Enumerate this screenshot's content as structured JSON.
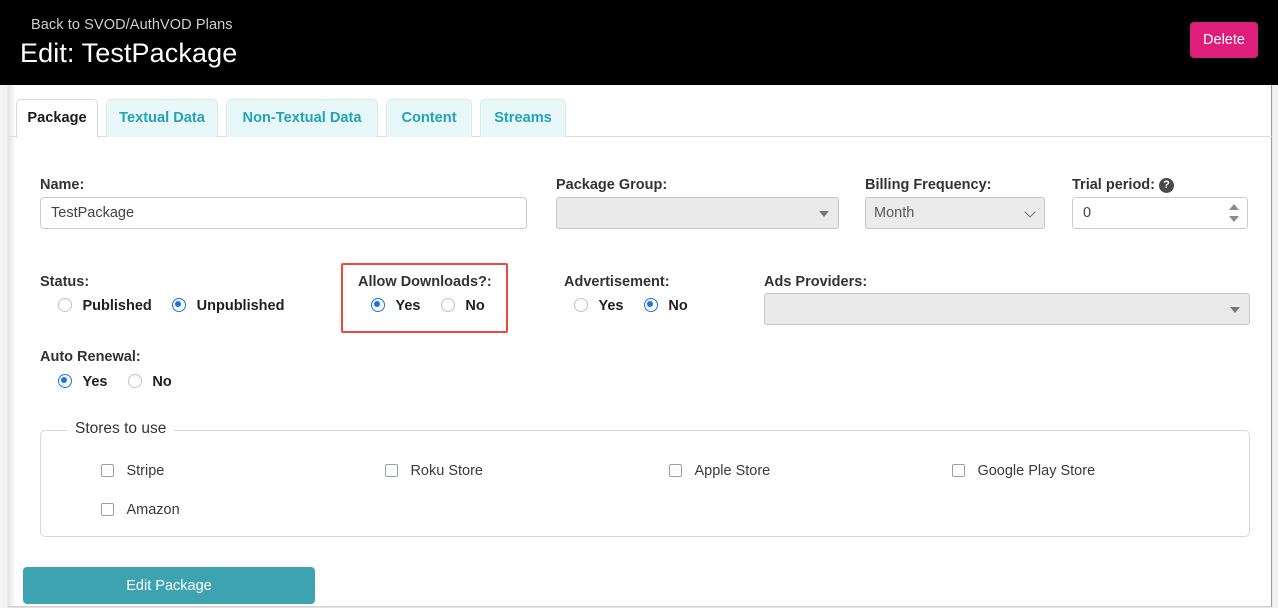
{
  "header": {
    "back_link": "Back to SVOD/AuthVOD Plans",
    "title": "Edit: TestPackage",
    "delete_label": "Delete",
    "delete_color": "#dd1e7a",
    "background": "#000000"
  },
  "tabs": [
    {
      "label": "Package",
      "active": true
    },
    {
      "label": "Textual Data",
      "active": false
    },
    {
      "label": "Non-Textual Data",
      "active": false
    },
    {
      "label": "Content",
      "active": false
    },
    {
      "label": "Streams",
      "active": false
    }
  ],
  "tab_colors": {
    "inactive_bg": "#e8f8f8",
    "inactive_text": "#22a3b8",
    "active_bg": "#ffffff",
    "active_text": "#1b1b1b"
  },
  "form": {
    "name": {
      "label": "Name:",
      "value": "TestPackage",
      "placeholder": ""
    },
    "package_group": {
      "label": "Package Group:",
      "value": "",
      "disabled": true
    },
    "billing_frequency": {
      "label": "Billing Frequency:",
      "value": "Month",
      "options": [
        "Month"
      ]
    },
    "trial_period": {
      "label": "Trial period:",
      "value": "0",
      "help_icon": "question-mark-icon"
    },
    "status": {
      "label": "Status:",
      "options": [
        {
          "label": "Published",
          "selected": false
        },
        {
          "label": "Unpublished",
          "selected": true
        }
      ]
    },
    "allow_downloads": {
      "label": "Allow Downloads?:",
      "highlighted": true,
      "highlight_color": "#f1483c",
      "options": [
        {
          "label": "Yes",
          "selected": true
        },
        {
          "label": "No",
          "selected": false
        }
      ]
    },
    "advertisement": {
      "label": "Advertisement:",
      "options": [
        {
          "label": "Yes",
          "selected": false
        },
        {
          "label": "No",
          "selected": true
        }
      ]
    },
    "ads_providers": {
      "label": "Ads Providers:",
      "value": "",
      "disabled": true
    },
    "auto_renewal": {
      "label": "Auto Renewal:",
      "options": [
        {
          "label": "Yes",
          "selected": true
        },
        {
          "label": "No",
          "selected": false
        }
      ]
    },
    "stores": {
      "legend": "Stores to use",
      "items": [
        {
          "label": "Stripe",
          "checked": false
        },
        {
          "label": "Roku Store",
          "checked": false
        },
        {
          "label": "Apple Store",
          "checked": false
        },
        {
          "label": "Google Play Store",
          "checked": false
        },
        {
          "label": "Amazon",
          "checked": false
        }
      ]
    },
    "submit": {
      "label": "Edit Package",
      "color": "#3da3b0"
    }
  },
  "radio_colors": {
    "selected": "#1a73e8",
    "unselected_border": "#c0c4c8"
  }
}
